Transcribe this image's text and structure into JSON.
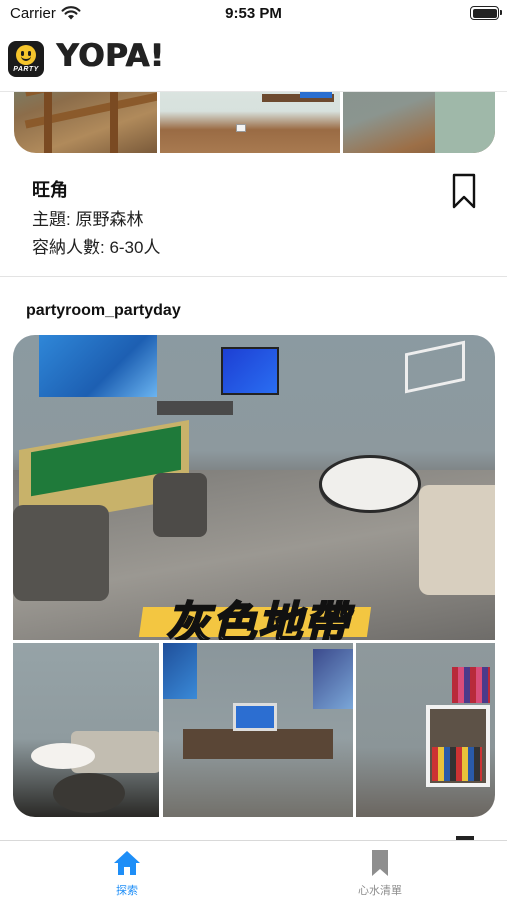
{
  "status_bar": {
    "carrier": "Carrier",
    "time": "9:53 PM",
    "battery_level": 1.0
  },
  "header": {
    "logo_text": "PARTY",
    "title": "YOPA!"
  },
  "listings": [
    {
      "name": "旺角",
      "theme": "主題: 原野森林",
      "capacity": "容納人數: 6-30人",
      "bookmark_icon": "bookmark-outline-icon"
    },
    {
      "name": "partyroom_partyday",
      "photo_caption": "灰色地帶"
    }
  ],
  "tab_bar": {
    "active_color": "#1e8ef7",
    "inactive_color": "#8e8e8e",
    "tabs": [
      {
        "label": "探索",
        "icon": "house-icon",
        "active": true
      },
      {
        "label": "心水清單",
        "icon": "bookmark-icon",
        "active": false
      }
    ]
  }
}
